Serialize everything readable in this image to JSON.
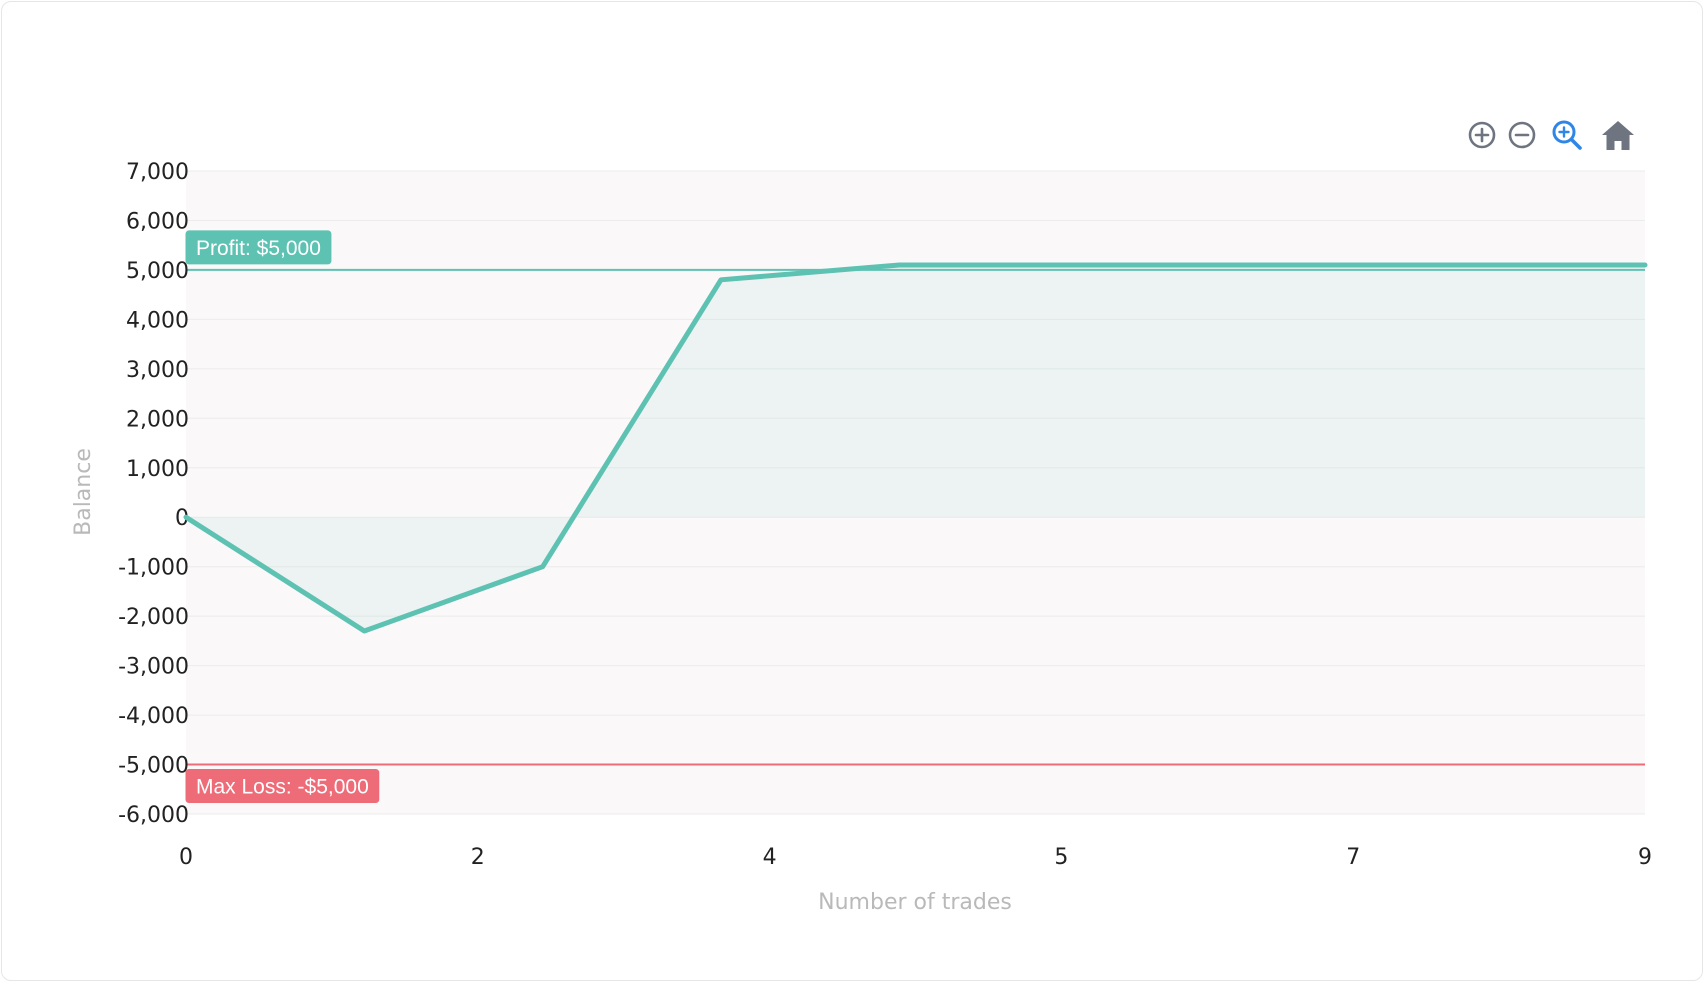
{
  "toolbar": {
    "zoom_in_icon": "plus-circle-icon",
    "zoom_out_icon": "minus-circle-icon",
    "zoom_select_icon": "magnifier-plus-icon",
    "reset_icon": "home-icon"
  },
  "chart_data": {
    "type": "area",
    "title": "",
    "xlabel": "Number of trades",
    "ylabel": "Balance",
    "x_tick_labels": [
      "0",
      "2",
      "4",
      "5",
      "7",
      "9"
    ],
    "y_tick_labels": [
      "7,000",
      "6,000",
      "5,000",
      "4,000",
      "3,000",
      "2,000",
      "1,000",
      "0",
      "-1,000",
      "-2,000",
      "-3,000",
      "-4,000",
      "-5,000",
      "-6,000"
    ],
    "ylim": [
      -6000,
      7000
    ],
    "xlim": [
      0,
      9
    ],
    "grid": true,
    "series": [
      {
        "x": [
          0,
          1.1,
          2.2,
          3.3,
          4.4,
          9
        ],
        "y": [
          0,
          -2300,
          -1000,
          4800,
          5100,
          5100
        ],
        "color": "#5ec2b2"
      }
    ],
    "annotations": [
      {
        "label": "Profit: $5,000",
        "y": 5000,
        "color": "#5ec2b2"
      },
      {
        "label": "Max Loss: -$5,000",
        "y": -5000,
        "color": "#ee6b78"
      }
    ],
    "colors": {
      "series": "#5ec2b2",
      "profit": "#5ec2b2",
      "loss": "#ee6b78",
      "grid": "#ececec",
      "plot_background": "#faf8f9"
    }
  }
}
